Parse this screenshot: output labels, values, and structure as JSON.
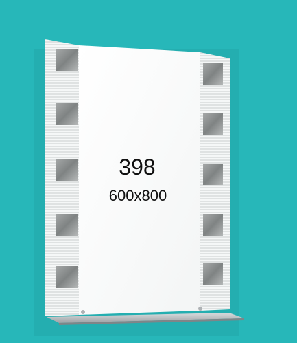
{
  "product": {
    "model_number": "398",
    "dimensions": "600x800"
  },
  "colors": {
    "background": "#27b7b9",
    "mirror": "#ffffff",
    "frosted_stripe": "#d9dddd",
    "square_panel": "#8f9191",
    "shelf": "#a9adb0"
  }
}
